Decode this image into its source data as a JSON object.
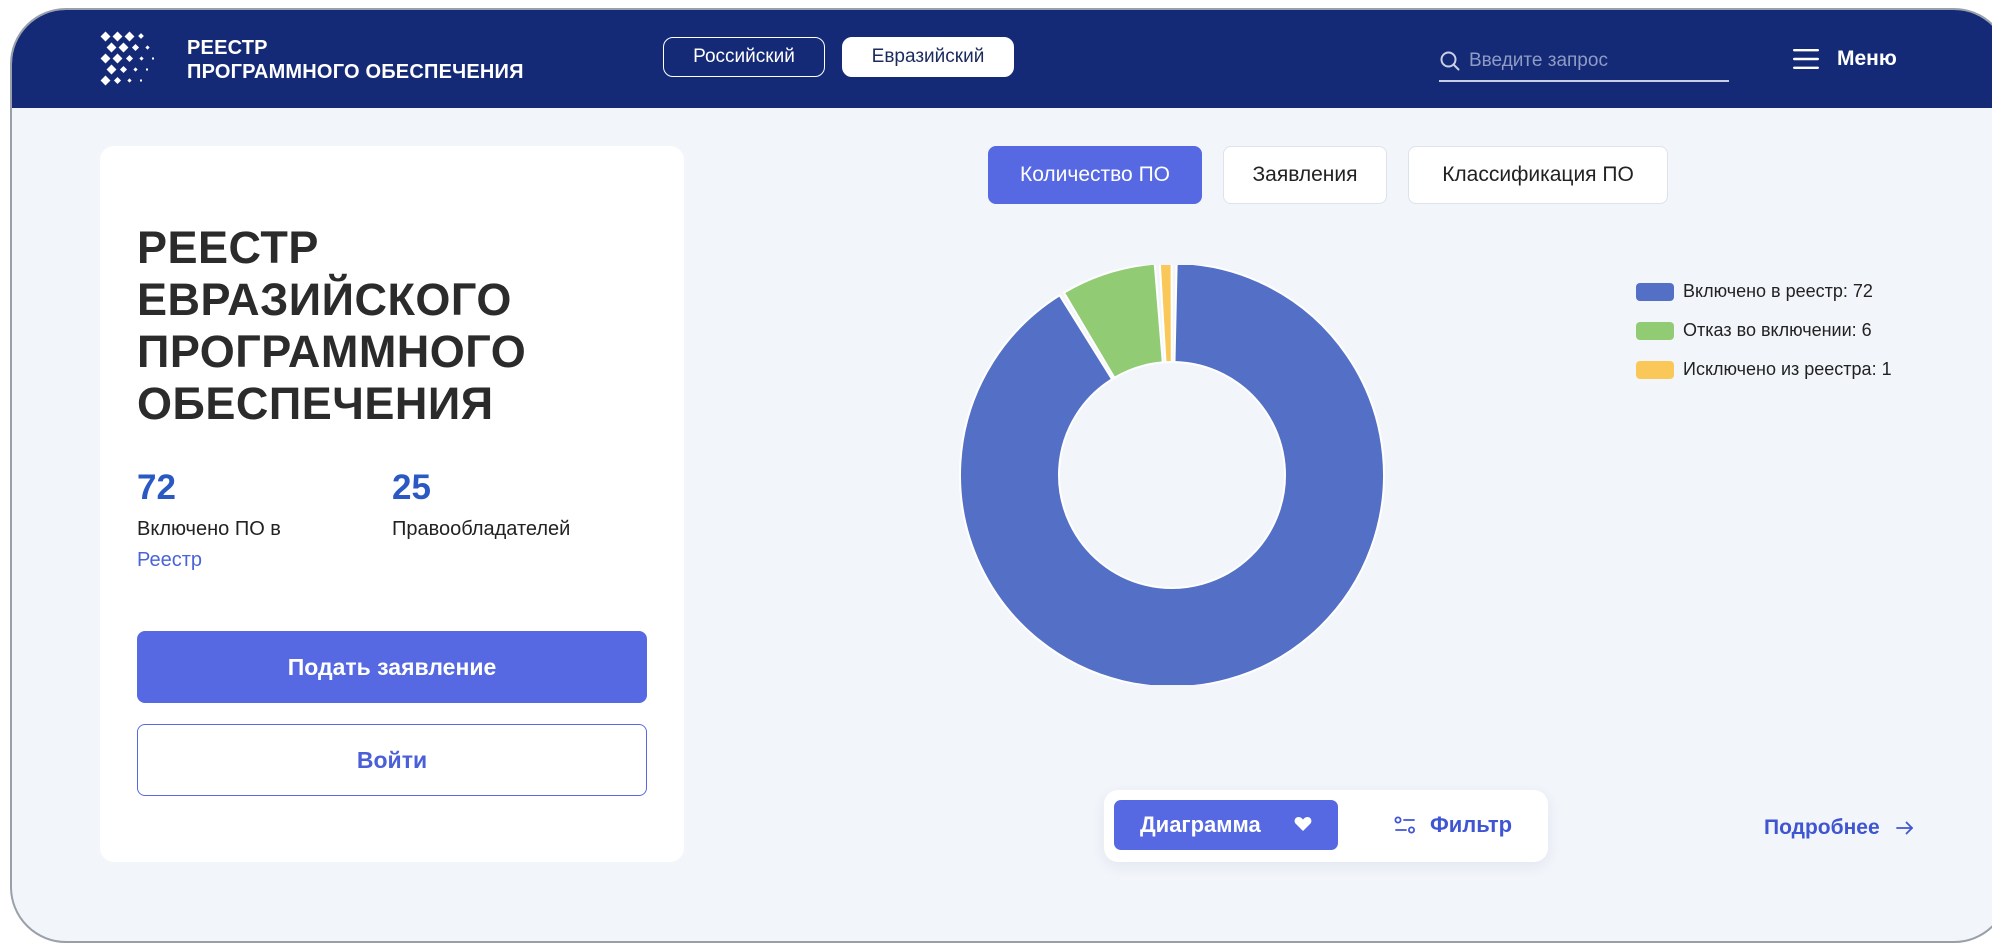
{
  "header": {
    "brand_line1": "РЕЕСТР",
    "brand_line2": "ПРОГРАММНОГО ОБЕСПЕЧЕНИЯ",
    "registry_tabs": [
      "Российский",
      "Евразийский"
    ],
    "active_registry_tab": "Евразийский",
    "search_placeholder": "Введите запрос",
    "menu_label": "Меню"
  },
  "card": {
    "title_lines": [
      "РЕЕСТР",
      "ЕВРАЗИЙСКОГО",
      "ПРОГРАММНОГО",
      "ОБЕСПЕЧЕНИЯ"
    ],
    "stats": [
      {
        "number": "72",
        "label_text": "Включено ПО в",
        "label_link": "Реестр"
      },
      {
        "number": "25",
        "label_text": "Правообладателей"
      }
    ],
    "primary_button": "Подать заявление",
    "secondary_button": "Войти"
  },
  "chart_tabs": [
    "Количество ПО",
    "Заявления",
    "Классификация ПО"
  ],
  "active_chart_tab": "Количество ПО",
  "chart_data": {
    "type": "pie",
    "title": "",
    "donut": true,
    "categories": [
      "Включено в реестр",
      "Отказ во включении",
      "Исключено из реестра"
    ],
    "values": [
      72,
      6,
      1
    ],
    "colors": [
      "#5470c6",
      "#91cc75",
      "#fac858"
    ],
    "legend_labels": [
      "Включено в реестр: 72",
      "Отказ во включении: 6",
      "Исключено из реестра: 1"
    ],
    "legend_position": "top-right"
  },
  "bottom_bar": {
    "view_selector_label": "Диаграмма",
    "filter_label": "Фильтр",
    "more_link_label": "Подробнее"
  },
  "colors": {
    "header_bg": "#152a77",
    "accent": "#5669e3",
    "page_bg": "#f2f5fa",
    "stat_number": "#2b59c3"
  }
}
